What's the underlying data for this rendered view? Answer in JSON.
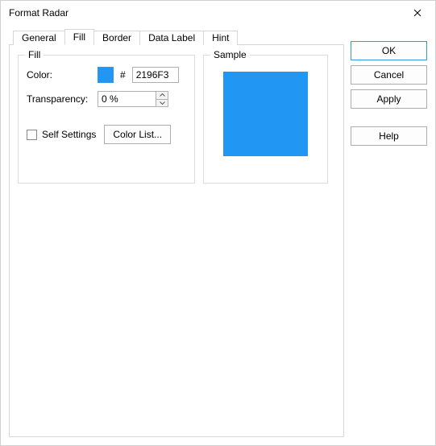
{
  "window": {
    "title": "Format Radar"
  },
  "tabs": {
    "general": "General",
    "fill": "Fill",
    "border": "Border",
    "data_label": "Data Label",
    "hint": "Hint",
    "active": "fill"
  },
  "fill": {
    "legend": "Fill",
    "color_label": "Color:",
    "hash": "#",
    "color_hex": "2196F3",
    "transparency_label": "Transparency:",
    "transparency_value": "0 %",
    "self_settings_label": "Self Settings",
    "self_settings_checked": false,
    "color_list_btn": "Color List..."
  },
  "sample": {
    "legend": "Sample",
    "color": "#2196F3"
  },
  "buttons": {
    "ok": "OK",
    "cancel": "Cancel",
    "apply": "Apply",
    "help": "Help"
  }
}
